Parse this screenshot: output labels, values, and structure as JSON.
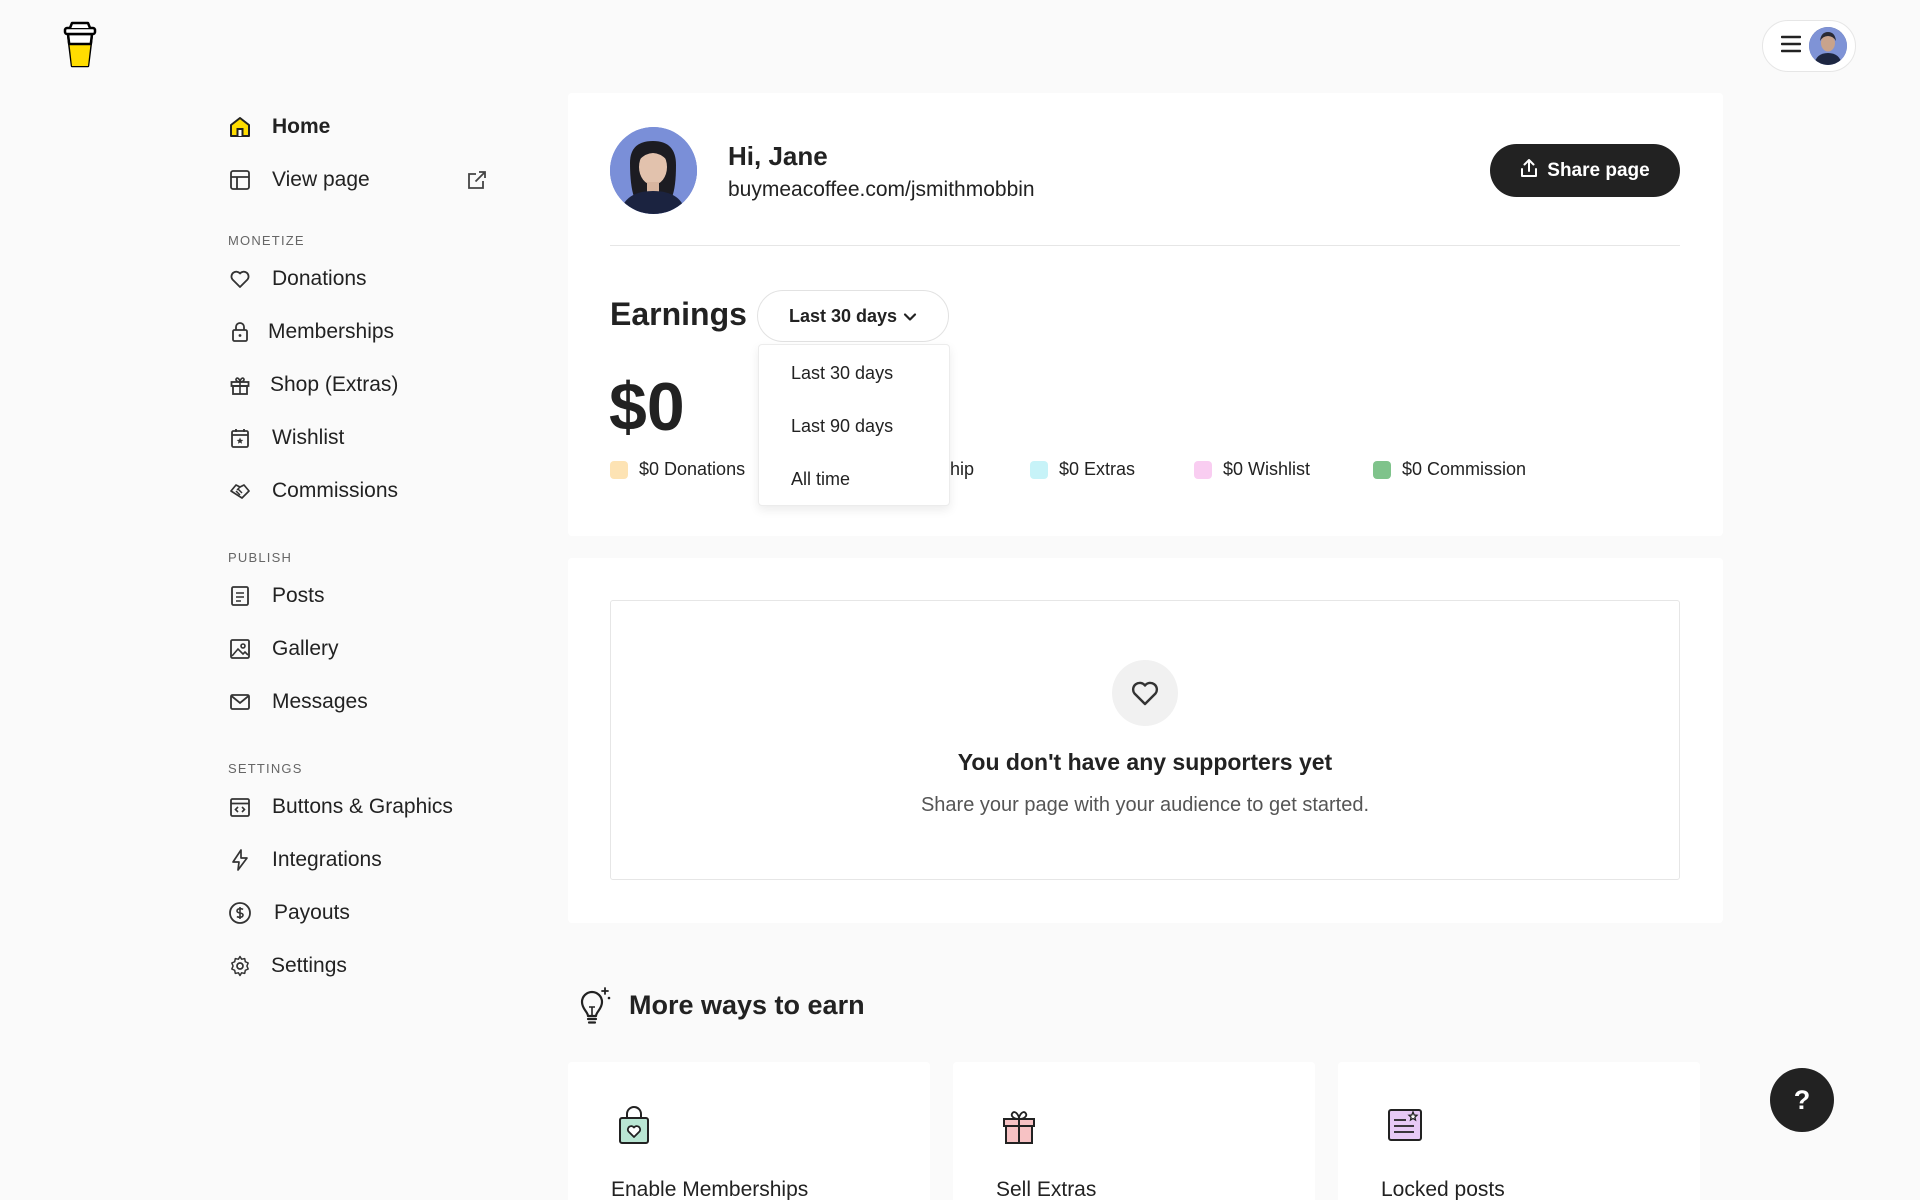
{
  "header": {
    "logo_icon": "coffee-cup-icon",
    "menu_icon": "hamburger-icon"
  },
  "sidebar": {
    "top_items": [
      {
        "label": "Home",
        "icon": "home-icon"
      },
      {
        "label": "View page",
        "icon": "layout-icon",
        "trailing_icon": "external-link-icon"
      }
    ],
    "sections": [
      {
        "title": "MONETIZE",
        "items": [
          {
            "label": "Donations",
            "icon": "heart-icon"
          },
          {
            "label": "Memberships",
            "icon": "lock-icon"
          },
          {
            "label": "Shop (Extras)",
            "icon": "gift-icon"
          },
          {
            "label": "Wishlist",
            "icon": "calendar-star-icon"
          },
          {
            "label": "Commissions",
            "icon": "handshake-icon"
          }
        ]
      },
      {
        "title": "PUBLISH",
        "items": [
          {
            "label": "Posts",
            "icon": "document-icon"
          },
          {
            "label": "Gallery",
            "icon": "image-icon"
          },
          {
            "label": "Messages",
            "icon": "mail-icon"
          }
        ]
      },
      {
        "title": "SETTINGS",
        "items": [
          {
            "label": "Buttons & Graphics",
            "icon": "code-window-icon"
          },
          {
            "label": "Integrations",
            "icon": "lightning-icon"
          },
          {
            "label": "Payouts",
            "icon": "dollar-circle-icon"
          },
          {
            "label": "Settings",
            "icon": "gear-icon"
          }
        ]
      }
    ]
  },
  "profile": {
    "greeting": "Hi, Jane",
    "url": "buymeacoffee.com/jsmithmobbin",
    "share_label": "Share page"
  },
  "earnings": {
    "title": "Earnings",
    "range_selected": "Last 30 days",
    "range_options": [
      "Last 30 days",
      "Last 90 days",
      "All time"
    ],
    "amount": "$0",
    "legend": [
      {
        "label": "$0 Donations",
        "color": "#fde3b4"
      },
      {
        "label": "$0 Membership",
        "color": "#f6cfa4"
      },
      {
        "label": "$0 Extras",
        "color": "#c7f3f8"
      },
      {
        "label": "$0 Wishlist",
        "color": "#f9cdf1"
      },
      {
        "label": "$0 Commission",
        "color": "#7fc38b"
      }
    ]
  },
  "supporters": {
    "empty_title": "You don't have any supporters yet",
    "empty_subtitle": "Share your page with your audience to get started."
  },
  "more_ways": {
    "title": "More ways to earn",
    "cards": [
      {
        "label": "Enable Memberships",
        "icon": "shopping-bag-heart-icon"
      },
      {
        "label": "Sell Extras",
        "icon": "gift-box-icon"
      },
      {
        "label": "Locked posts",
        "icon": "locked-post-icon"
      }
    ]
  },
  "help": {
    "label": "?"
  }
}
